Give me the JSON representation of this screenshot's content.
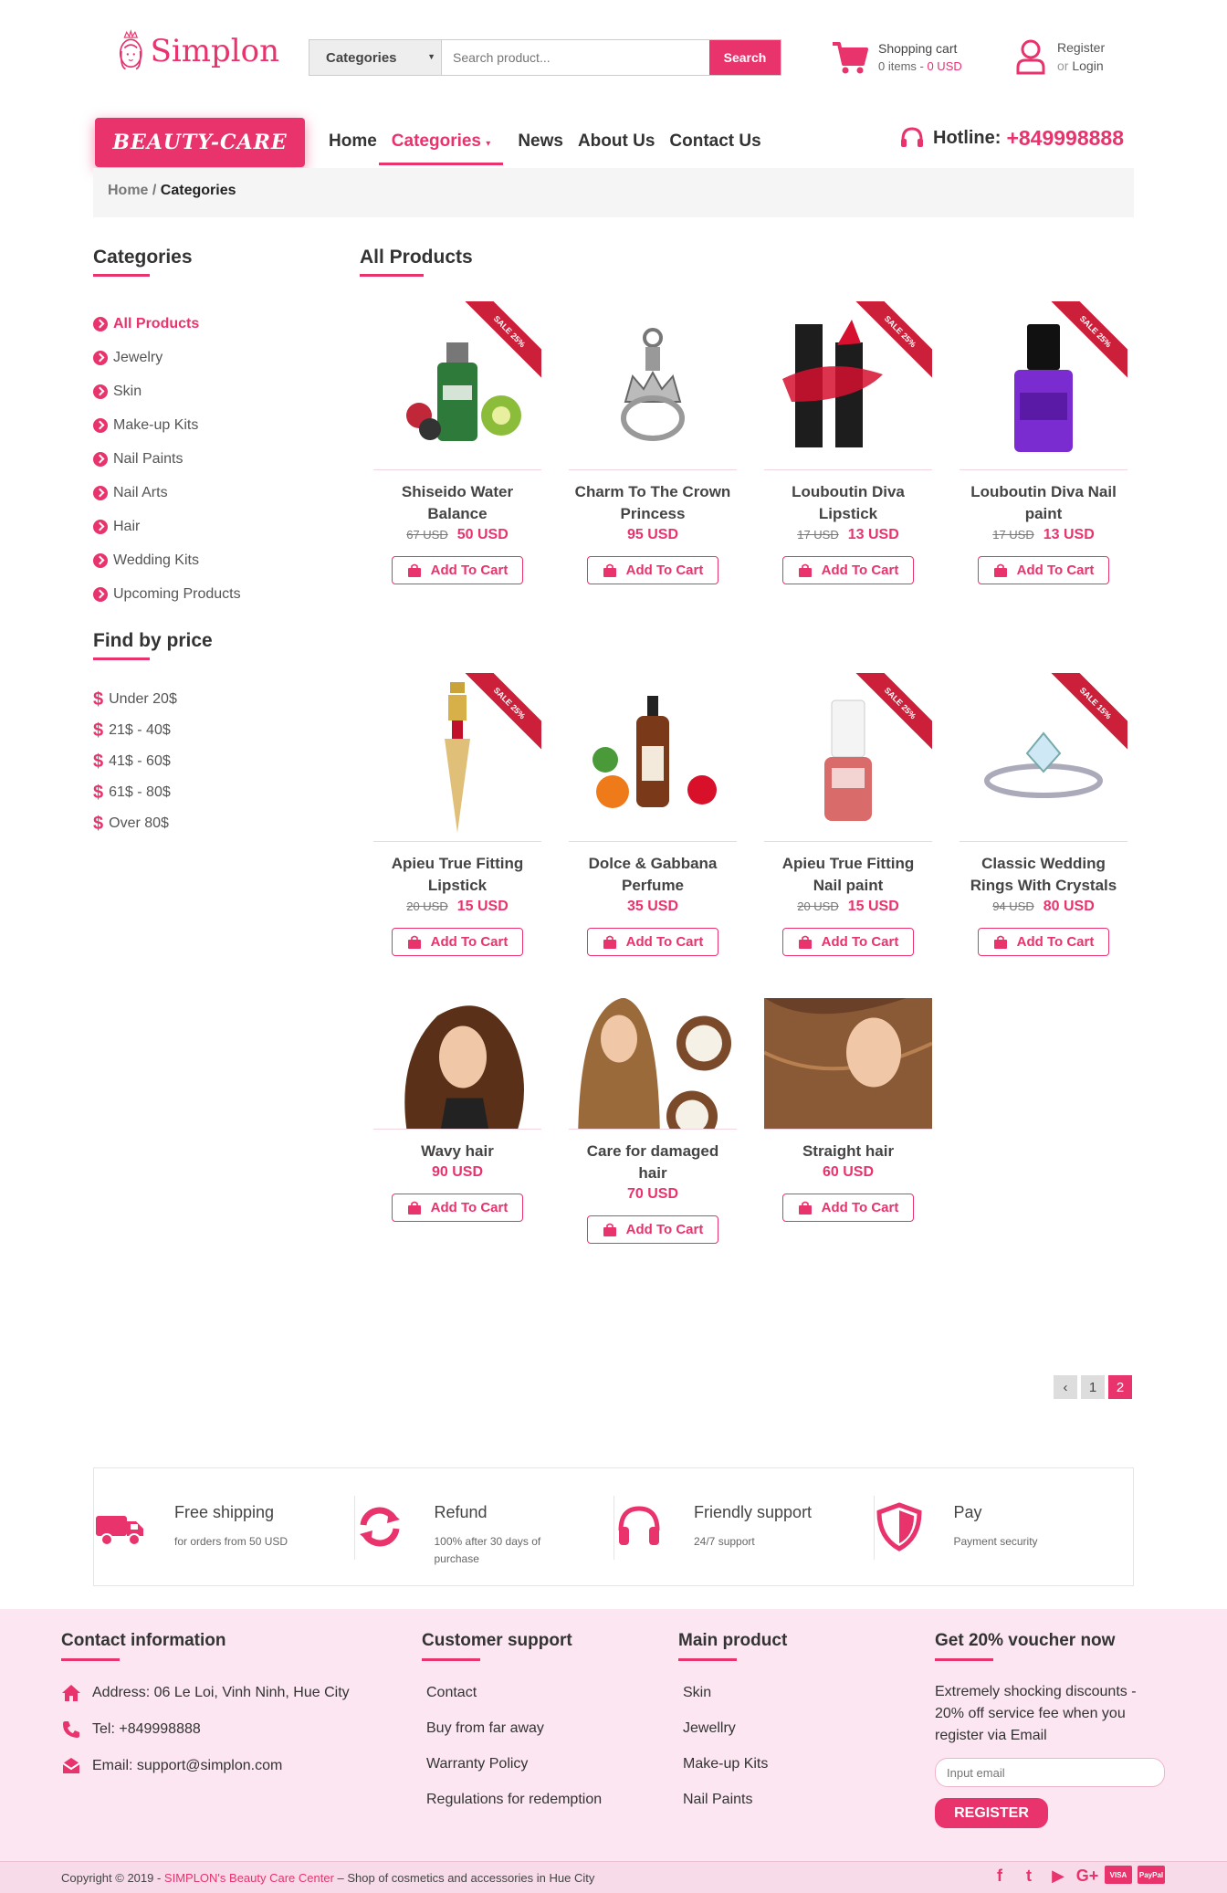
{
  "brand": {
    "name": "Simplon",
    "badge": "BEAUTY-CARE"
  },
  "search": {
    "category": "Categories",
    "placeholder": "Search product...",
    "button": "Search"
  },
  "cart": {
    "label": "Shopping cart",
    "items": "0 items - ",
    "amount": "0 USD"
  },
  "account": {
    "register": "Register",
    "or": "or ",
    "login": "Login"
  },
  "nav": {
    "home": "Home",
    "categories": "Categories",
    "news": "News",
    "about": "About Us",
    "contact": "Contact Us"
  },
  "hotline": {
    "label": "Hotline:",
    "number": "+849998888"
  },
  "breadcrumb": {
    "home": "Home",
    "sep": " / ",
    "current": "Categories"
  },
  "sidebar": {
    "categories_title": "Categories",
    "categories": [
      "All Products",
      "Jewelry",
      "Skin",
      "Make-up Kits",
      "Nail Paints",
      "Nail Arts",
      "Hair",
      "Wedding Kits",
      "Upcoming Products"
    ],
    "price_title": "Find by price",
    "prices": [
      "Under 20$",
      "21$ - 40$",
      "41$ - 60$",
      "61$ - 80$",
      "Over 80$"
    ]
  },
  "products_title": "All Products",
  "add_to_cart": "Add To Cart",
  "products": [
    {
      "name": "Shiseido  Water Balance",
      "old": "67 USD",
      "price": "50 USD",
      "sale": "SALE 25%"
    },
    {
      "name": "Charm To The Crown Princess",
      "old": "",
      "price": "95 USD",
      "sale": ""
    },
    {
      "name": "Louboutin Diva Lipstick",
      "old": "17 USD",
      "price": "13 USD",
      "sale": "SALE 25%"
    },
    {
      "name": "Louboutin Diva Nail paint",
      "old": "17 USD",
      "price": "13 USD",
      "sale": "SALE 25%"
    },
    {
      "name": "Apieu True Fitting Lipstick",
      "old": "20 USD",
      "price": "15 USD",
      "sale": "SALE 25%"
    },
    {
      "name": "Dolce & Gabbana Perfume",
      "old": "",
      "price": "35 USD",
      "sale": ""
    },
    {
      "name": "Apieu True Fitting Nail paint",
      "old": "20 USD",
      "price": "15 USD",
      "sale": "SALE 25%"
    },
    {
      "name": "Classic Wedding Rings With Crystals",
      "old": "94 USD",
      "price": "80 USD",
      "sale": "SALE 15%"
    },
    {
      "name": "Wavy hair",
      "old": "",
      "price": "90 USD",
      "sale": ""
    },
    {
      "name": "Care for damaged hair",
      "old": "",
      "price": "70 USD",
      "sale": ""
    },
    {
      "name": "Straight hair",
      "old": "",
      "price": "60 USD",
      "sale": ""
    }
  ],
  "pagination": {
    "prev": "‹",
    "pages": [
      "1",
      "2"
    ],
    "current": "2"
  },
  "features": [
    {
      "title": "Free shipping",
      "desc": "for orders from 50 USD",
      "icon": "truck-icon"
    },
    {
      "title": "Refund",
      "desc": "100% after 30 days of purchase",
      "icon": "refresh-icon"
    },
    {
      "title": "Friendly support",
      "desc": "24/7 support",
      "icon": "headphones-icon"
    },
    {
      "title": "Pay",
      "desc": "Payment security",
      "icon": "shield-icon"
    }
  ],
  "footer": {
    "contact_title": "Contact information",
    "address": "Address: 06 Le Loi, Vinh Ninh, Hue City",
    "tel": "Tel: +849998888",
    "email": "Email: support@simplon.com",
    "support_title": "Customer support",
    "support": [
      "Contact",
      "Buy from far away",
      "Warranty Policy",
      "Regulations for redemption"
    ],
    "main_title": "Main product",
    "main": [
      "Skin",
      "Jewellry",
      "Make-up Kits",
      "Nail Paints"
    ],
    "voucher_title": "Get 20% voucher now",
    "voucher_text": "Extremely shocking discounts - 20% off service fee when you register via Email",
    "voucher_placeholder": "Input email",
    "voucher_button": "REGISTER",
    "copyright_pre": "Copyright © 2019 - ",
    "copyright_brand": "SIMPLON's Beauty Care Center",
    "copyright_post": " – Shop of cosmetics and accessories in Hue City",
    "social": [
      "f",
      "t",
      "▶",
      "G+",
      "VISA",
      "PayPal"
    ]
  },
  "colors": {
    "accent": "#e8336d",
    "footer_bg": "#fbe6f1"
  }
}
